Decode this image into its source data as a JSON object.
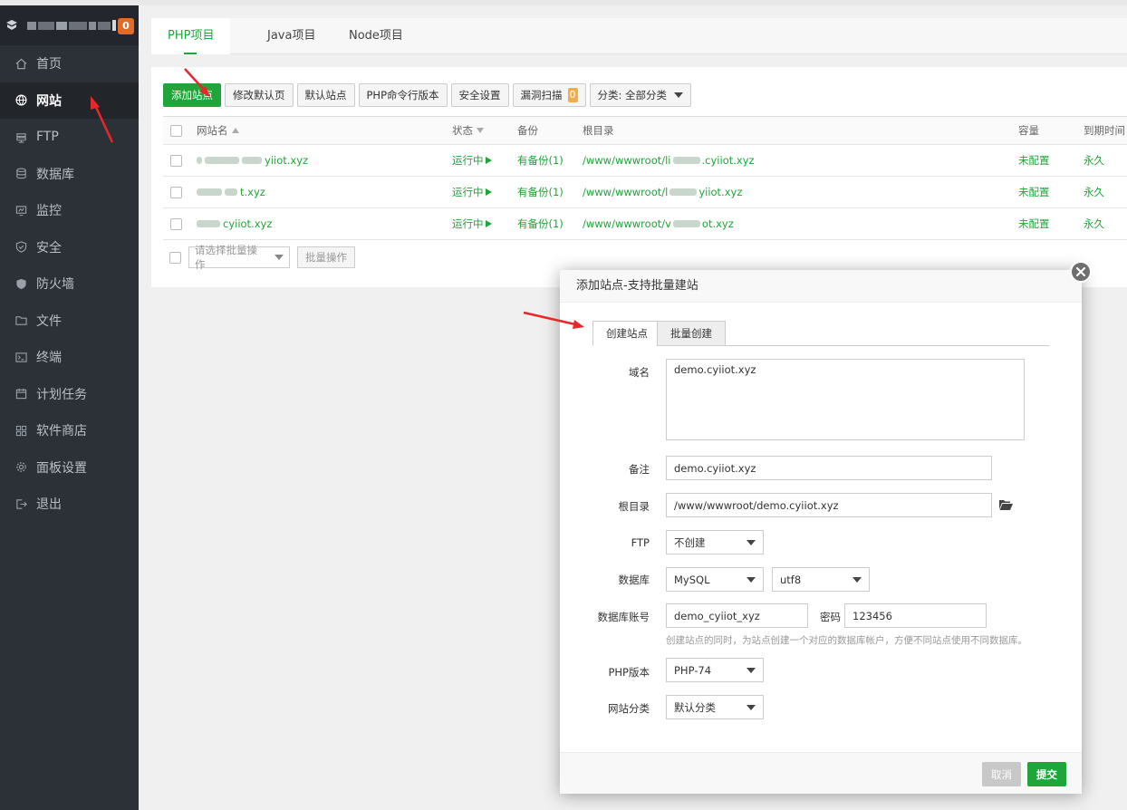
{
  "sidebar": {
    "badge": "0",
    "items": [
      {
        "label": "首页",
        "icon": "home-icon"
      },
      {
        "label": "网站",
        "icon": "globe-icon"
      },
      {
        "label": "FTP",
        "icon": "ftp-icon"
      },
      {
        "label": "数据库",
        "icon": "database-icon"
      },
      {
        "label": "监控",
        "icon": "monitor-icon"
      },
      {
        "label": "安全",
        "icon": "shield-icon"
      },
      {
        "label": "防火墙",
        "icon": "firewall-icon"
      },
      {
        "label": "文件",
        "icon": "folder-icon"
      },
      {
        "label": "终端",
        "icon": "terminal-icon"
      },
      {
        "label": "计划任务",
        "icon": "calendar-icon"
      },
      {
        "label": "软件商店",
        "icon": "grid-icon"
      },
      {
        "label": "面板设置",
        "icon": "gear-icon"
      },
      {
        "label": "退出",
        "icon": "logout-icon"
      }
    ]
  },
  "project_tabs": [
    "PHP项目",
    "Java项目",
    "Node项目"
  ],
  "toolbar": {
    "add_site": "添加站点",
    "modify_default_page": "修改默认页",
    "default_site": "默认站点",
    "php_cli_version": "PHP命令行版本",
    "security_settings": "安全设置",
    "vuln_scan": "漏洞扫描",
    "vuln_count": "0",
    "category": "分类: 全部分类"
  },
  "table": {
    "headers": {
      "name": "网站名",
      "status": "状态",
      "backup": "备份",
      "root": "根目录",
      "capacity": "容量",
      "expire": "到期时间"
    },
    "rows": [
      {
        "name": "yiiot.xyz",
        "status": "运行中",
        "backup": "有备份(1)",
        "root_prefix": "/www/wwwroot/li",
        "root_suffix": ".cyiiot.xyz",
        "capacity": "未配置",
        "expire": "永久"
      },
      {
        "name": "t.xyz",
        "status": "运行中",
        "backup": "有备份(1)",
        "root_prefix": "/www/wwwroot/l",
        "root_suffix": "yiiot.xyz",
        "capacity": "未配置",
        "expire": "永久"
      },
      {
        "name": "cyiiot.xyz",
        "status": "运行中",
        "backup": "有备份(1)",
        "root_prefix": "/www/wwwroot/v",
        "root_suffix": "ot.xyz",
        "capacity": "未配置",
        "expire": "永久"
      }
    ]
  },
  "batch": {
    "select_placeholder": "请选择批量操作",
    "button": "批量操作"
  },
  "dialog": {
    "title": "添加站点-支持批量建站",
    "tabs": [
      "创建站点",
      "批量创建"
    ],
    "fields": {
      "domain_label": "域名",
      "domain_value": "demo.cyiiot.xyz",
      "remark_label": "备注",
      "remark_value": "demo.cyiiot.xyz",
      "root_label": "根目录",
      "root_value": "/www/wwwroot/demo.cyiiot.xyz",
      "ftp_label": "FTP",
      "ftp_value": "不创建",
      "db_label": "数据库",
      "db_type": "MySQL",
      "db_charset": "utf8",
      "db_account_label": "数据库账号",
      "db_account_value": "demo_cyiiot_xyz",
      "db_password_label": "密码",
      "db_password_value": "123456",
      "db_hint": "创建站点的同时，为站点创建一个对应的数据库帐户，方便不同站点使用不同数据库。",
      "php_label": "PHP版本",
      "php_value": "PHP-74",
      "category_label": "网站分类",
      "category_value": "默认分类"
    },
    "cancel": "取消",
    "submit": "提交"
  },
  "colors": {
    "accent": "#20a53a",
    "sidebar_bg": "#2c3138",
    "badge": "#e06c2b",
    "arrow": "#e8272b"
  }
}
